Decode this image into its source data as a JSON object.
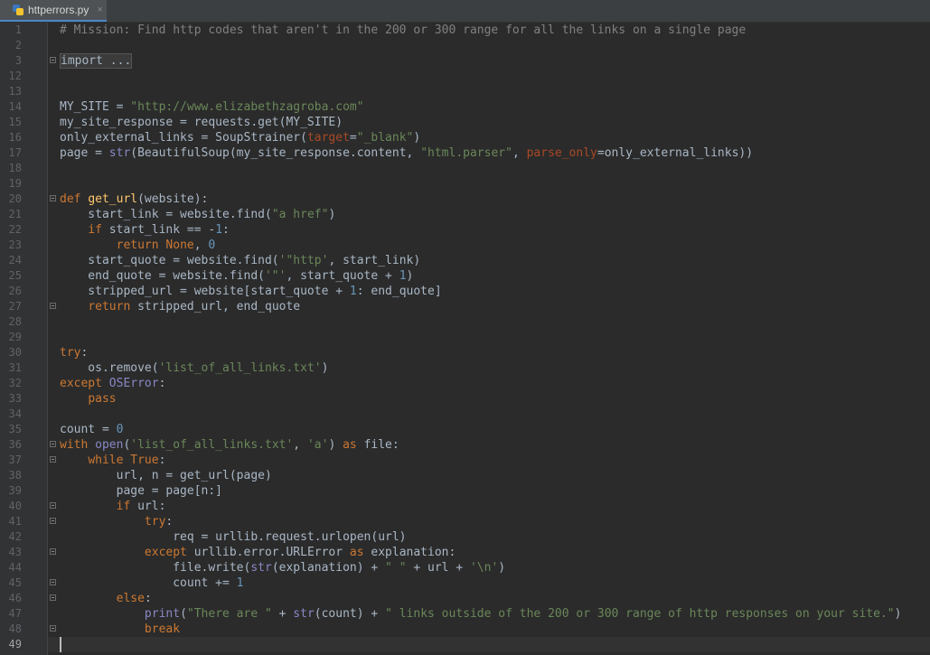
{
  "tab": {
    "filename": "httperrors.py",
    "close_glyph": "×"
  },
  "colors": {
    "comment": "#808080",
    "string": "#6a8759",
    "keyword": "#cc7832",
    "number": "#6897bb",
    "builtin": "#8888c6",
    "param": "#aa4926",
    "function": "#ffc66d",
    "plain": "#a9b7c6"
  },
  "current_line": "49",
  "lines": [
    {
      "n": "1",
      "fold": false,
      "tokens": [
        [
          "comment",
          "# Mission: Find http codes that aren't in the 200 or 300 range for all the links on a single page"
        ]
      ]
    },
    {
      "n": "2",
      "fold": false,
      "tokens": []
    },
    {
      "n": "3",
      "fold": true,
      "tokens": [
        [
          "folded",
          "import ..."
        ]
      ]
    },
    {
      "n": "12",
      "fold": false,
      "tokens": []
    },
    {
      "n": "13",
      "fold": false,
      "tokens": []
    },
    {
      "n": "14",
      "fold": false,
      "tokens": [
        [
          "plain",
          "MY_SITE = "
        ],
        [
          "string",
          "\"http://www.elizabethzagroba.com\""
        ]
      ]
    },
    {
      "n": "15",
      "fold": false,
      "tokens": [
        [
          "plain",
          "my_site_response = requests.get(MY_SITE)"
        ]
      ]
    },
    {
      "n": "16",
      "fold": false,
      "tokens": [
        [
          "plain",
          "only_external_links = SoupStrainer("
        ],
        [
          "param",
          "target"
        ],
        [
          "plain",
          "="
        ],
        [
          "string",
          "\"_blank\""
        ],
        [
          "plain",
          ")"
        ]
      ]
    },
    {
      "n": "17",
      "fold": false,
      "tokens": [
        [
          "plain",
          "page = "
        ],
        [
          "builtin",
          "str"
        ],
        [
          "plain",
          "(BeautifulSoup(my_site_response.content, "
        ],
        [
          "string",
          "\"html.parser\""
        ],
        [
          "plain",
          ", "
        ],
        [
          "param",
          "parse_only"
        ],
        [
          "plain",
          "=only_external_links))"
        ]
      ]
    },
    {
      "n": "18",
      "fold": false,
      "tokens": []
    },
    {
      "n": "19",
      "fold": false,
      "tokens": []
    },
    {
      "n": "20",
      "fold": true,
      "tokens": [
        [
          "keyword",
          "def "
        ],
        [
          "function",
          "get_url"
        ],
        [
          "plain",
          "(website):"
        ]
      ]
    },
    {
      "n": "21",
      "fold": false,
      "tokens": [
        [
          "plain",
          "    start_link = website.find("
        ],
        [
          "string",
          "\"a href\""
        ],
        [
          "plain",
          ")"
        ]
      ]
    },
    {
      "n": "22",
      "fold": false,
      "tokens": [
        [
          "plain",
          "    "
        ],
        [
          "keyword",
          "if "
        ],
        [
          "plain",
          "start_link == -"
        ],
        [
          "number",
          "1"
        ],
        [
          "plain",
          ":"
        ]
      ]
    },
    {
      "n": "23",
      "fold": false,
      "tokens": [
        [
          "plain",
          "        "
        ],
        [
          "keyword",
          "return None"
        ],
        [
          "plain",
          ", "
        ],
        [
          "number",
          "0"
        ]
      ]
    },
    {
      "n": "24",
      "fold": false,
      "tokens": [
        [
          "plain",
          "    start_quote = website.find("
        ],
        [
          "string",
          "'\"http'"
        ],
        [
          "plain",
          ", start_link)"
        ]
      ]
    },
    {
      "n": "25",
      "fold": false,
      "tokens": [
        [
          "plain",
          "    end_quote = website.find("
        ],
        [
          "string",
          "'\"'"
        ],
        [
          "plain",
          ", start_quote + "
        ],
        [
          "number",
          "1"
        ],
        [
          "plain",
          ")"
        ]
      ]
    },
    {
      "n": "26",
      "fold": false,
      "tokens": [
        [
          "plain",
          "    stripped_url = website[start_quote + "
        ],
        [
          "number",
          "1"
        ],
        [
          "plain",
          ": end_quote]"
        ]
      ]
    },
    {
      "n": "27",
      "fold": true,
      "tokens": [
        [
          "plain",
          "    "
        ],
        [
          "keyword",
          "return "
        ],
        [
          "plain",
          "stripped_url, end_quote"
        ]
      ]
    },
    {
      "n": "28",
      "fold": false,
      "tokens": []
    },
    {
      "n": "29",
      "fold": false,
      "tokens": []
    },
    {
      "n": "30",
      "fold": false,
      "tokens": [
        [
          "keyword",
          "try"
        ],
        [
          "plain",
          ":"
        ]
      ]
    },
    {
      "n": "31",
      "fold": false,
      "tokens": [
        [
          "plain",
          "    os.remove("
        ],
        [
          "string",
          "'list_of_all_links.txt'"
        ],
        [
          "plain",
          ")"
        ]
      ]
    },
    {
      "n": "32",
      "fold": false,
      "tokens": [
        [
          "keyword",
          "except "
        ],
        [
          "builtin",
          "OSError"
        ],
        [
          "plain",
          ":"
        ]
      ]
    },
    {
      "n": "33",
      "fold": false,
      "tokens": [
        [
          "plain",
          "    "
        ],
        [
          "keyword",
          "pass"
        ]
      ]
    },
    {
      "n": "34",
      "fold": false,
      "tokens": []
    },
    {
      "n": "35",
      "fold": false,
      "tokens": [
        [
          "plain",
          "count = "
        ],
        [
          "number",
          "0"
        ]
      ]
    },
    {
      "n": "36",
      "fold": true,
      "tokens": [
        [
          "keyword",
          "with "
        ],
        [
          "builtin",
          "open"
        ],
        [
          "plain",
          "("
        ],
        [
          "string",
          "'list_of_all_links.txt'"
        ],
        [
          "plain",
          ", "
        ],
        [
          "string",
          "'a'"
        ],
        [
          "plain",
          ") "
        ],
        [
          "keyword",
          "as "
        ],
        [
          "plain",
          "file:"
        ]
      ]
    },
    {
      "n": "37",
      "fold": true,
      "tokens": [
        [
          "plain",
          "    "
        ],
        [
          "keyword",
          "while True"
        ],
        [
          "plain",
          ":"
        ]
      ]
    },
    {
      "n": "38",
      "fold": false,
      "tokens": [
        [
          "plain",
          "        url, n = get_url(page)"
        ]
      ]
    },
    {
      "n": "39",
      "fold": false,
      "tokens": [
        [
          "plain",
          "        page = page[n:]"
        ]
      ]
    },
    {
      "n": "40",
      "fold": true,
      "tokens": [
        [
          "plain",
          "        "
        ],
        [
          "keyword",
          "if "
        ],
        [
          "plain",
          "url:"
        ]
      ]
    },
    {
      "n": "41",
      "fold": true,
      "tokens": [
        [
          "plain",
          "            "
        ],
        [
          "keyword",
          "try"
        ],
        [
          "plain",
          ":"
        ]
      ]
    },
    {
      "n": "42",
      "fold": false,
      "tokens": [
        [
          "plain",
          "                req = urllib.request.urlopen(url)"
        ]
      ]
    },
    {
      "n": "43",
      "fold": true,
      "tokens": [
        [
          "plain",
          "            "
        ],
        [
          "keyword",
          "except "
        ],
        [
          "plain",
          "urllib.error.URLError "
        ],
        [
          "keyword",
          "as "
        ],
        [
          "plain",
          "explanation:"
        ]
      ]
    },
    {
      "n": "44",
      "fold": false,
      "tokens": [
        [
          "plain",
          "                file.write("
        ],
        [
          "builtin",
          "str"
        ],
        [
          "plain",
          "(explanation) + "
        ],
        [
          "string",
          "\" \""
        ],
        [
          "plain",
          " + url + "
        ],
        [
          "string",
          "'\\n'"
        ],
        [
          "plain",
          ")"
        ]
      ]
    },
    {
      "n": "45",
      "fold": true,
      "tokens": [
        [
          "plain",
          "                count += "
        ],
        [
          "number",
          "1"
        ]
      ]
    },
    {
      "n": "46",
      "fold": true,
      "tokens": [
        [
          "plain",
          "        "
        ],
        [
          "keyword",
          "else"
        ],
        [
          "plain",
          ":"
        ]
      ]
    },
    {
      "n": "47",
      "fold": false,
      "tokens": [
        [
          "plain",
          "            "
        ],
        [
          "builtin",
          "print"
        ],
        [
          "plain",
          "("
        ],
        [
          "string",
          "\"There are \""
        ],
        [
          "plain",
          " + "
        ],
        [
          "builtin",
          "str"
        ],
        [
          "plain",
          "(count) + "
        ],
        [
          "string",
          "\" links outside of the 200 or 300 range of http responses on your site.\""
        ],
        [
          "plain",
          ")"
        ]
      ]
    },
    {
      "n": "48",
      "fold": true,
      "tokens": [
        [
          "plain",
          "            "
        ],
        [
          "keyword",
          "break"
        ]
      ]
    },
    {
      "n": "49",
      "fold": false,
      "tokens": []
    }
  ]
}
